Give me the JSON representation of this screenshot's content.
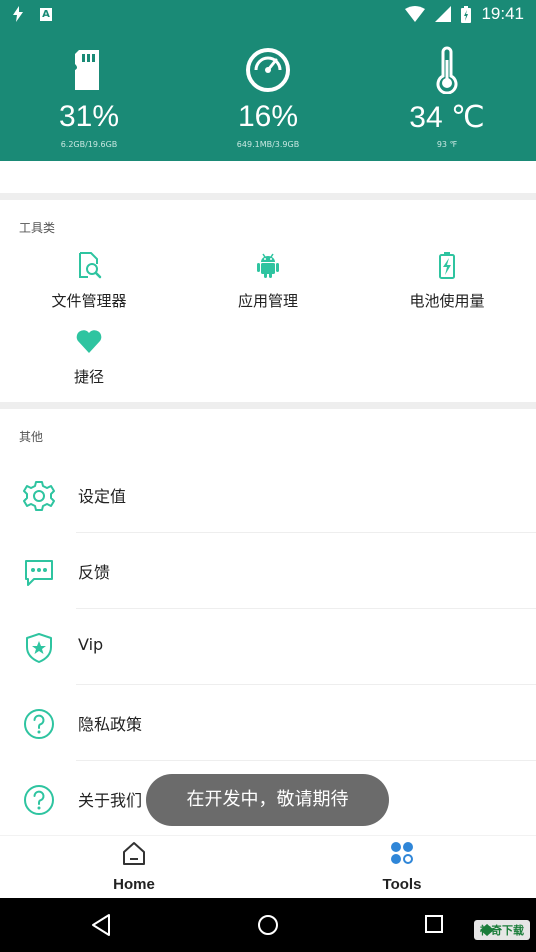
{
  "status_bar": {
    "time": "19:41",
    "left_badge": "A"
  },
  "header": {
    "stats": [
      {
        "icon": "sd-card-icon",
        "value": "31%",
        "sub": "6.2GB/19.6GB"
      },
      {
        "icon": "speedometer-icon",
        "value": "16%",
        "sub": "649.1MB/3.9GB"
      },
      {
        "icon": "thermometer-icon",
        "value": "34 ℃",
        "sub": "93 ℉"
      }
    ]
  },
  "tools_section": {
    "title": "工具类",
    "items": [
      {
        "icon": "file-search-icon",
        "label": "文件管理器"
      },
      {
        "icon": "android-icon",
        "label": "应用管理"
      },
      {
        "icon": "battery-charging-icon",
        "label": "电池使用量"
      },
      {
        "icon": "heart-icon",
        "label": "捷径"
      }
    ]
  },
  "other_section": {
    "title": "其他",
    "items": [
      {
        "icon": "gear-icon",
        "label": "设定值"
      },
      {
        "icon": "chat-icon",
        "label": "反馈"
      },
      {
        "icon": "shield-star-icon",
        "label": "Vip"
      },
      {
        "icon": "help-circle-icon",
        "label": "隐私政策"
      },
      {
        "icon": "help-circle-icon",
        "label": "关于我们"
      }
    ]
  },
  "bottom_nav": {
    "items": [
      {
        "icon": "home-icon",
        "label": "Home"
      },
      {
        "icon": "tools-grid-icon",
        "label": "Tools"
      }
    ]
  },
  "toast": {
    "text": "在开发中，敬请期待"
  },
  "watermark": {
    "text": "神奇下载"
  },
  "colors": {
    "primary": "#1a8a76",
    "accent": "#2ec4a0",
    "nav_active": "#2f86d8"
  }
}
